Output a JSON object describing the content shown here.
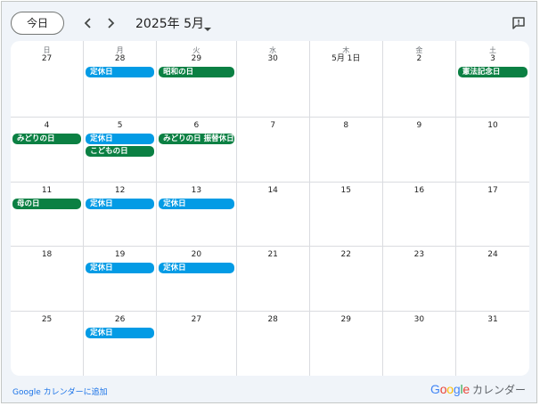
{
  "toolbar": {
    "today_label": "今日",
    "month_title": "2025年 5月",
    "prev_icon": "chevron-left-icon",
    "next_icon": "chevron-right-icon",
    "feedback_icon": "feedback-icon"
  },
  "weekdays": [
    "日",
    "月",
    "火",
    "水",
    "木",
    "金",
    "土"
  ],
  "colors": {
    "blue": "#039be5",
    "green": "#0b8043"
  },
  "weeks": [
    [
      {
        "day": "27",
        "events": []
      },
      {
        "day": "28",
        "events": [
          {
            "title": "定休日",
            "color": "blue"
          }
        ]
      },
      {
        "day": "29",
        "events": [
          {
            "title": "昭和の日",
            "color": "green"
          }
        ]
      },
      {
        "day": "30",
        "events": []
      },
      {
        "day": "5月 1日",
        "events": []
      },
      {
        "day": "2",
        "events": []
      },
      {
        "day": "3",
        "events": [
          {
            "title": "憲法記念日",
            "color": "green"
          }
        ]
      }
    ],
    [
      {
        "day": "4",
        "events": [
          {
            "title": "みどりの日",
            "color": "green"
          }
        ]
      },
      {
        "day": "5",
        "events": [
          {
            "title": "定休日",
            "color": "blue"
          },
          {
            "title": "こどもの日",
            "color": "green"
          }
        ]
      },
      {
        "day": "6",
        "events": [
          {
            "title": "みどりの日 振替休日",
            "color": "green"
          }
        ]
      },
      {
        "day": "7",
        "events": []
      },
      {
        "day": "8",
        "events": []
      },
      {
        "day": "9",
        "events": []
      },
      {
        "day": "10",
        "events": []
      }
    ],
    [
      {
        "day": "11",
        "events": [
          {
            "title": "母の日",
            "color": "green"
          }
        ]
      },
      {
        "day": "12",
        "events": [
          {
            "title": "定休日",
            "color": "blue"
          }
        ]
      },
      {
        "day": "13",
        "events": [
          {
            "title": "定休日",
            "color": "blue"
          }
        ]
      },
      {
        "day": "14",
        "events": []
      },
      {
        "day": "15",
        "events": []
      },
      {
        "day": "16",
        "events": []
      },
      {
        "day": "17",
        "events": []
      }
    ],
    [
      {
        "day": "18",
        "events": []
      },
      {
        "day": "19",
        "events": [
          {
            "title": "定休日",
            "color": "blue"
          }
        ]
      },
      {
        "day": "20",
        "events": [
          {
            "title": "定休日",
            "color": "blue"
          }
        ]
      },
      {
        "day": "21",
        "events": []
      },
      {
        "day": "22",
        "events": []
      },
      {
        "day": "23",
        "events": []
      },
      {
        "day": "24",
        "events": []
      }
    ],
    [
      {
        "day": "25",
        "events": []
      },
      {
        "day": "26",
        "events": [
          {
            "title": "定休日",
            "color": "blue"
          }
        ]
      },
      {
        "day": "27",
        "events": []
      },
      {
        "day": "28",
        "events": []
      },
      {
        "day": "29",
        "events": []
      },
      {
        "day": "30",
        "events": []
      },
      {
        "day": "31",
        "events": []
      }
    ]
  ],
  "footer": {
    "add_link": "Google カレンダーに追加",
    "brand_letters": [
      {
        "ch": "G",
        "color": "#4285f4"
      },
      {
        "ch": "o",
        "color": "#ea4335"
      },
      {
        "ch": "o",
        "color": "#fbbc05"
      },
      {
        "ch": "g",
        "color": "#4285f4"
      },
      {
        "ch": "l",
        "color": "#34a853"
      },
      {
        "ch": "e",
        "color": "#ea4335"
      }
    ],
    "brand_suffix": "カレンダー"
  }
}
